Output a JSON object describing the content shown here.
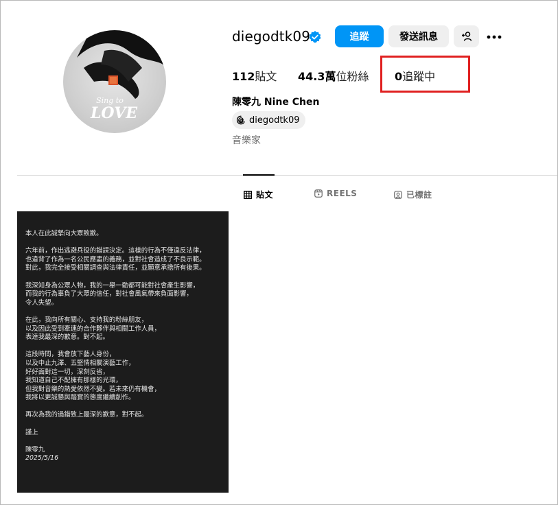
{
  "profile": {
    "username": "diegodtk09",
    "follow_label": "追蹤",
    "message_label": "發送訊息",
    "posts_count": "112",
    "posts_label": "貼文",
    "followers_count": "44.3萬",
    "followers_label": "位粉絲",
    "following_count": "0",
    "following_label": "追蹤中",
    "full_name": "陳零九 Nine Chen",
    "threads_handle": "diegodtk09",
    "category": "音樂家",
    "avatar_text": "Sing to LOVE"
  },
  "tabs": {
    "posts": "貼文",
    "reels": "REELS",
    "tagged": "已標註"
  },
  "post": {
    "paragraphs": [
      "本人在此誠摯向大眾致歉。",
      "六年前，作出逃避兵役的錯誤決定。這樣的行為不僅違反法律，\n也違背了作為一名公民應盡的義務，並對社會造成了不良示範。\n對此，我完全接受相關調查與法律責任，並願意承擔所有後果。",
      "我深知身為公眾人物，我的一舉一動都可能對社會產生影響，\n而我的行為辜負了大眾的信任，對社會風氣帶來負面影響，\n令人失望。",
      "在此，我向所有關心、支持我的粉絲朋友，\n以及因此受到牽連的合作夥伴與相關工作人員，\n表達我最深的歉意。對不起。",
      "這段時間，我會放下藝人身份，\n以及中止九澤、五堅情相關演藝工作，\n好好面對這一切，深刻反省，\n我知道自己不配擁有那樣的光環，\n但我對音樂的熱愛依然不變。若未來仍有機會，\n我將以更誠懇與踏實的態度繼續創作。",
      "再次為我的過錯致上最深的歉意，對不起。",
      "謹上"
    ],
    "signature": "陳零九",
    "date": "2025/5/16"
  }
}
